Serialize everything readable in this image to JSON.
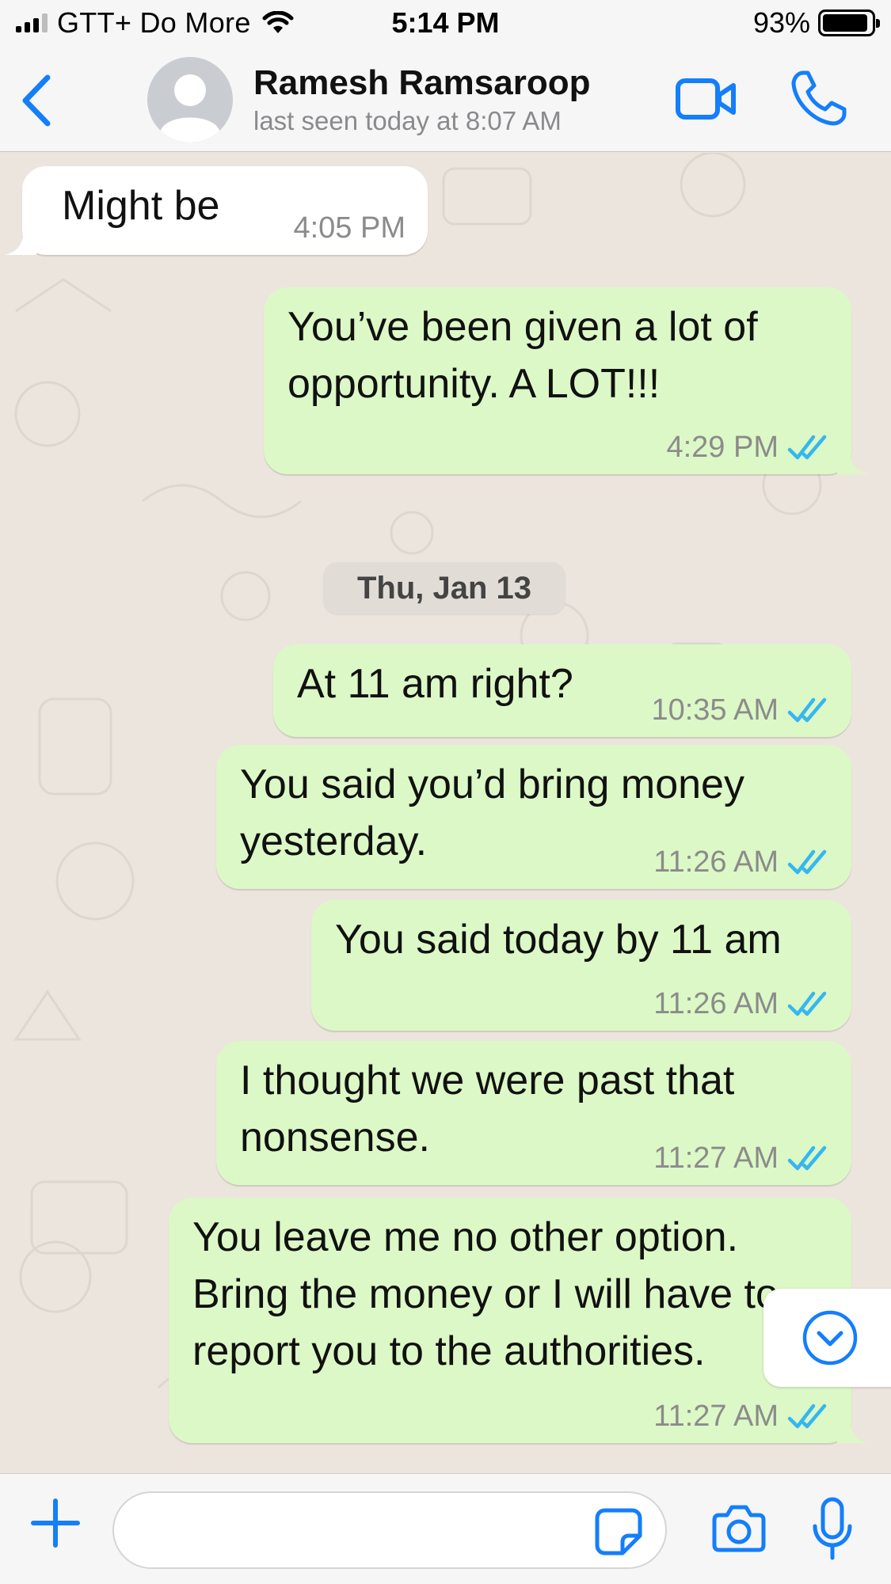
{
  "status_bar": {
    "carrier": "GTT+ Do More",
    "time": "5:14 PM",
    "battery_percent": "93%",
    "battery_level": 0.93,
    "signal_bars": 3
  },
  "header": {
    "contact_name": "Ramesh Ramsaroop",
    "last_seen": "last seen today at 8:07 AM",
    "icons": [
      "back-icon",
      "avatar-placeholder",
      "video-call-icon",
      "phone-icon"
    ]
  },
  "messages": [
    {
      "direction": "in",
      "text": "Might be",
      "time": "4:05 PM"
    },
    {
      "direction": "out",
      "text": "You’ve been given a lot of\nopportunity. A LOT!!!",
      "time": "4:29 PM",
      "status": "read"
    },
    {
      "direction": "out",
      "text": "At 11 am right?",
      "time": "10:35 AM",
      "status": "read"
    },
    {
      "direction": "out",
      "text": "You said you’d bring money\nyesterday.",
      "time": "11:26 AM",
      "status": "read"
    },
    {
      "direction": "out",
      "text": "You said today by 11 am",
      "time": "11:26 AM",
      "status": "read"
    },
    {
      "direction": "out",
      "text": "I thought we were past that\nnonsense.",
      "time": "11:27 AM",
      "status": "read"
    },
    {
      "direction": "out",
      "text": "You leave me no other option.\nBring the money or I will have to\nreport you to the authorities.",
      "time": "11:27 AM",
      "status": "read"
    }
  ],
  "date_separator": "Thu, Jan 13",
  "input_bar": {
    "value": "",
    "icons": [
      "plus-icon",
      "sticker-icon",
      "camera-icon",
      "microphone-icon"
    ]
  },
  "colors": {
    "accent": "#147efb",
    "outgoing_bubble": "#dcf8c6",
    "incoming_bubble": "#ffffff",
    "chat_background": "#ece5dd",
    "read_ticks": "#34b7f1"
  }
}
